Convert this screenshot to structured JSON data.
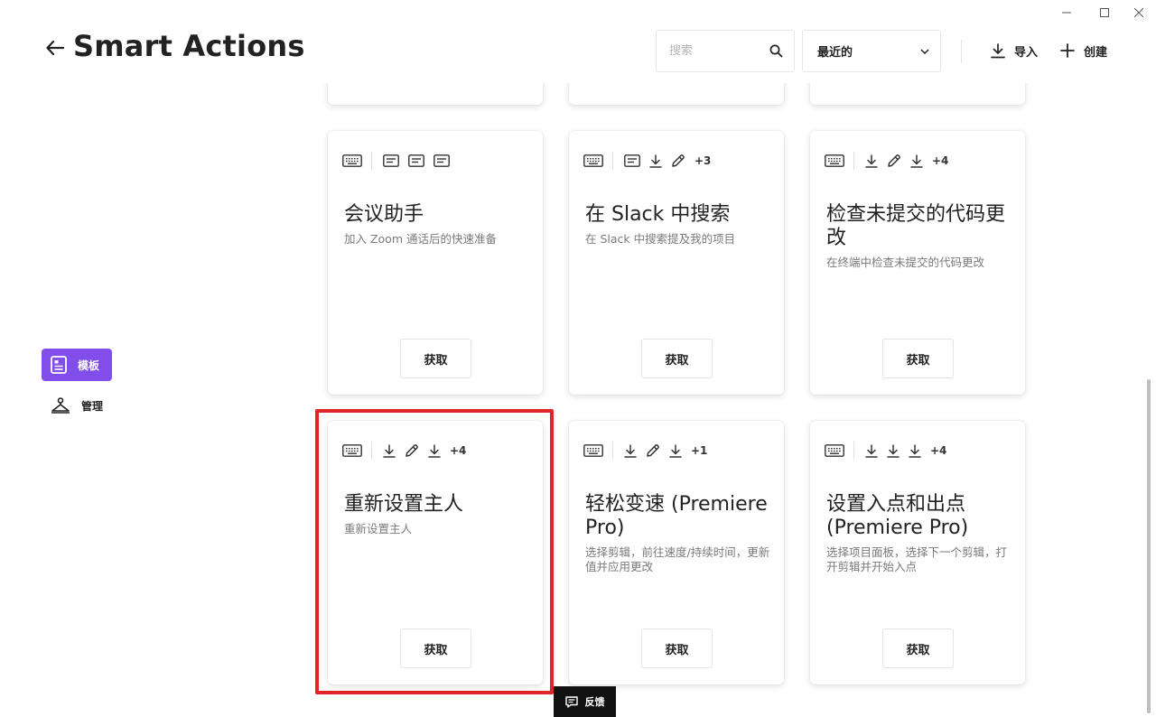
{
  "app": {
    "title": "Smart Actions"
  },
  "header": {
    "search_placeholder": "搜索",
    "sort_selected": "最近的",
    "import_label": "导入",
    "create_label": "创建"
  },
  "sidebar": {
    "items": [
      {
        "label": "模板",
        "active": true
      },
      {
        "label": "管理",
        "active": false
      }
    ]
  },
  "cards": [
    {
      "title": "会议助手",
      "title_bold": "",
      "title_rest": "",
      "description": "加入 Zoom 通话后的快速准备",
      "icons": [
        "keyboard-icon",
        "text-icon",
        "text-icon",
        "text-icon"
      ],
      "more": "",
      "button": "获取"
    },
    {
      "title": "在 Slack 中搜索",
      "title_bold": "",
      "title_rest": "",
      "description": "在 Slack 中搜索提及我的项目",
      "icons": [
        "keyboard-icon",
        "text-icon",
        "download-icon",
        "pencil-icon"
      ],
      "more": "+3",
      "button": "获取"
    },
    {
      "title": "检查未提交的代码更改",
      "title_bold": "",
      "title_rest": "",
      "description": "在终端中检查未提交的代码更改",
      "icons": [
        "keyboard-icon",
        "download-icon",
        "pencil-icon",
        "download-icon"
      ],
      "more": "+4",
      "button": "获取"
    },
    {
      "title": "重新设置主人",
      "title_bold": "",
      "title_rest": "",
      "description": "重新设置主人",
      "icons": [
        "keyboard-icon",
        "download-icon",
        "pencil-icon",
        "download-icon"
      ],
      "more": "+4",
      "button": "获取"
    },
    {
      "title": "轻松变速 (Premiere Pro)",
      "title_bold": "",
      "title_rest": "",
      "description": "选择剪辑，前往速度/持续时间，更新值并应用更改",
      "icons": [
        "keyboard-icon",
        "download-icon",
        "pencil-icon",
        "download-icon"
      ],
      "more": "+1",
      "button": "获取"
    },
    {
      "title": "设置入点和出点 (Premiere Pro)",
      "title_bold": "",
      "title_rest": "",
      "description": "选择项目面板，选择下一个剪辑，打开剪辑并开始入点",
      "icons": [
        "keyboard-icon",
        "download-icon",
        "download-icon",
        "download-icon"
      ],
      "more": "+4",
      "button": "获取"
    }
  ],
  "feedback_label": "反馈",
  "colors": {
    "accent": "#814eeb",
    "highlight": "#e1242a"
  }
}
